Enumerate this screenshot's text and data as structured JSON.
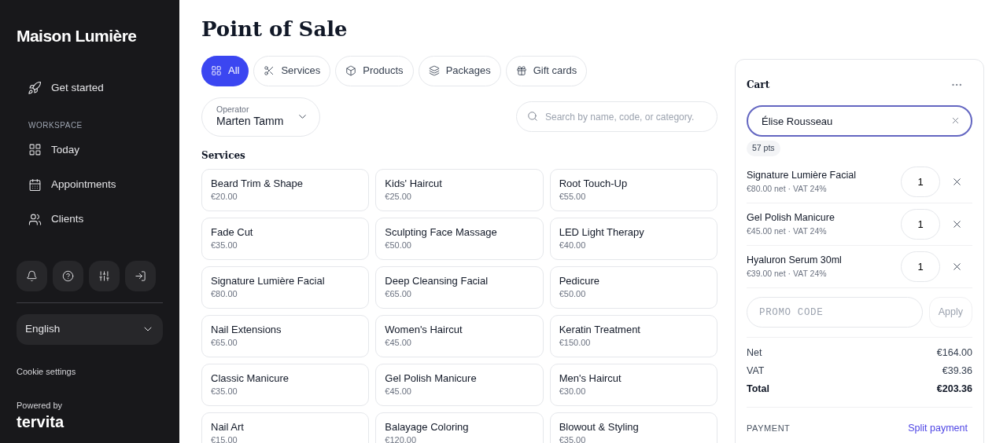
{
  "sidebar": {
    "brand": "Maison Lumière",
    "top_item": "Get started",
    "section": "WORKSPACE",
    "items": [
      "Today",
      "Appointments",
      "Clients"
    ],
    "language": "English",
    "cookie_link": "Cookie settings",
    "powered_by": "Powered by",
    "vendor": "tervita"
  },
  "title": "Point of Sale",
  "tabs": [
    {
      "label": "All",
      "selected": true
    },
    {
      "label": "Services",
      "selected": false
    },
    {
      "label": "Products",
      "selected": false
    },
    {
      "label": "Packages",
      "selected": false
    },
    {
      "label": "Gift cards",
      "selected": false
    }
  ],
  "operator": {
    "label": "Operator",
    "value": "Marten Tamm"
  },
  "search": {
    "placeholder": "Search by name, code, or category."
  },
  "section": "Services",
  "services": [
    {
      "name": "Beard Trim & Shape",
      "price": "€20.00"
    },
    {
      "name": "Kids' Haircut",
      "price": "€25.00"
    },
    {
      "name": "Root Touch-Up",
      "price": "€55.00"
    },
    {
      "name": "Fade Cut",
      "price": "€35.00"
    },
    {
      "name": "Sculpting Face Massage",
      "price": "€50.00"
    },
    {
      "name": "LED Light Therapy",
      "price": "€40.00"
    },
    {
      "name": "Signature Lumière Facial",
      "price": "€80.00"
    },
    {
      "name": "Deep Cleansing Facial",
      "price": "€65.00"
    },
    {
      "name": "Pedicure",
      "price": "€50.00"
    },
    {
      "name": "Nail Extensions",
      "price": "€65.00"
    },
    {
      "name": "Women's Haircut",
      "price": "€45.00"
    },
    {
      "name": "Keratin Treatment",
      "price": "€150.00"
    },
    {
      "name": "Classic Manicure",
      "price": "€35.00"
    },
    {
      "name": "Gel Polish Manicure",
      "price": "€45.00"
    },
    {
      "name": "Men's Haircut",
      "price": "€30.00"
    },
    {
      "name": "Nail Art",
      "price": "€15.00"
    },
    {
      "name": "Balayage Coloring",
      "price": "€120.00"
    },
    {
      "name": "Blowout & Styling",
      "price": "€35.00"
    }
  ],
  "cart": {
    "title": "Cart",
    "client": "Élise Rousseau",
    "points": "57 pts",
    "items": [
      {
        "name": "Signature Lumière Facial",
        "detail": "€80.00 net · VAT 24%",
        "qty": "1"
      },
      {
        "name": "Gel Polish Manicure",
        "detail": "€45.00 net · VAT 24%",
        "qty": "1"
      },
      {
        "name": "Hyaluron Serum 30ml",
        "detail": "€39.00 net · VAT 24%",
        "qty": "1"
      }
    ],
    "promo_placeholder": "PROMO CODE",
    "apply": "Apply",
    "totals": [
      {
        "label": "Net",
        "value": "€164.00",
        "kind": "normal"
      },
      {
        "label": "VAT",
        "value": "€39.36",
        "kind": "normal"
      },
      {
        "label": "Total",
        "value": "€203.36",
        "kind": "total"
      }
    ],
    "payment_label": "PAYMENT",
    "split_link": "Split payment"
  }
}
